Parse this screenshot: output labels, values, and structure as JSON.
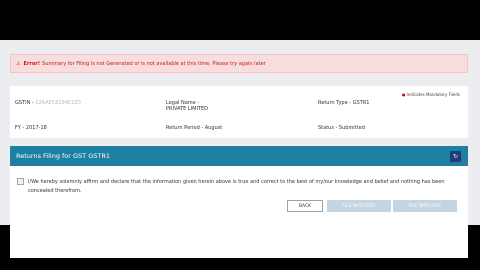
{
  "error": {
    "label": "Error!",
    "message": "Summary for Filing is not Generated or is not available at this time. Please try again later"
  },
  "info": {
    "mandatory_note": "Indicates Mandatory Fields",
    "gstin_label": "GSTIN -",
    "gstin_value": "22AAEC8294E1Z0",
    "legal_name_label": "Legal Name -",
    "legal_name_value": "PRIVATE LIMITED",
    "return_type_label": "Return Type -",
    "return_type_value": "GSTR1",
    "fy_label": "FY -",
    "fy_value": "2017-18",
    "return_period_label": "Return Period -",
    "return_period_value": "August",
    "status_label": "Status -",
    "status_value": "Submitted"
  },
  "returns": {
    "header": "Returns Filing for GST GSTR1",
    "declaration": "I/We hereby solemnly affirm and declare that the information given herein above is true and correct to the best of my/our knowledge and belief and nothing has been concealed therefrom.",
    "back_label": "BACK",
    "dsc_label": "FILE WITH DSC",
    "evc_label": "FILE WITH EVC"
  },
  "colors": {
    "header_bg": "#1f7fa0",
    "error_bg": "#f7dede",
    "error_text": "#b4231f",
    "disabled_btn": "#c5d4e2"
  }
}
